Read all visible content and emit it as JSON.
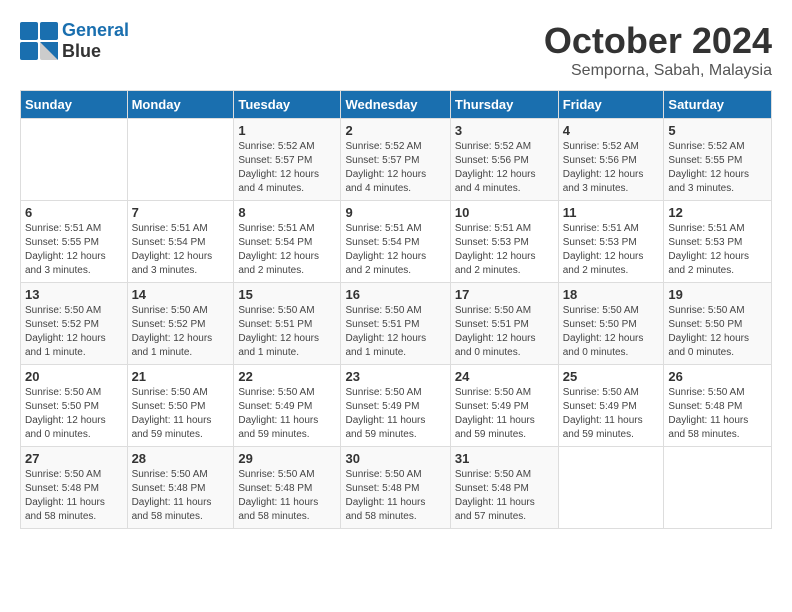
{
  "logo": {
    "line1": "General",
    "line2": "Blue"
  },
  "title": "October 2024",
  "location": "Semporna, Sabah, Malaysia",
  "weekdays": [
    "Sunday",
    "Monday",
    "Tuesday",
    "Wednesday",
    "Thursday",
    "Friday",
    "Saturday"
  ],
  "weeks": [
    [
      {
        "day": "",
        "content": ""
      },
      {
        "day": "",
        "content": ""
      },
      {
        "day": "1",
        "content": "Sunrise: 5:52 AM\nSunset: 5:57 PM\nDaylight: 12 hours\nand 4 minutes."
      },
      {
        "day": "2",
        "content": "Sunrise: 5:52 AM\nSunset: 5:57 PM\nDaylight: 12 hours\nand 4 minutes."
      },
      {
        "day": "3",
        "content": "Sunrise: 5:52 AM\nSunset: 5:56 PM\nDaylight: 12 hours\nand 4 minutes."
      },
      {
        "day": "4",
        "content": "Sunrise: 5:52 AM\nSunset: 5:56 PM\nDaylight: 12 hours\nand 3 minutes."
      },
      {
        "day": "5",
        "content": "Sunrise: 5:52 AM\nSunset: 5:55 PM\nDaylight: 12 hours\nand 3 minutes."
      }
    ],
    [
      {
        "day": "6",
        "content": "Sunrise: 5:51 AM\nSunset: 5:55 PM\nDaylight: 12 hours\nand 3 minutes."
      },
      {
        "day": "7",
        "content": "Sunrise: 5:51 AM\nSunset: 5:54 PM\nDaylight: 12 hours\nand 3 minutes."
      },
      {
        "day": "8",
        "content": "Sunrise: 5:51 AM\nSunset: 5:54 PM\nDaylight: 12 hours\nand 2 minutes."
      },
      {
        "day": "9",
        "content": "Sunrise: 5:51 AM\nSunset: 5:54 PM\nDaylight: 12 hours\nand 2 minutes."
      },
      {
        "day": "10",
        "content": "Sunrise: 5:51 AM\nSunset: 5:53 PM\nDaylight: 12 hours\nand 2 minutes."
      },
      {
        "day": "11",
        "content": "Sunrise: 5:51 AM\nSunset: 5:53 PM\nDaylight: 12 hours\nand 2 minutes."
      },
      {
        "day": "12",
        "content": "Sunrise: 5:51 AM\nSunset: 5:53 PM\nDaylight: 12 hours\nand 2 minutes."
      }
    ],
    [
      {
        "day": "13",
        "content": "Sunrise: 5:50 AM\nSunset: 5:52 PM\nDaylight: 12 hours\nand 1 minute."
      },
      {
        "day": "14",
        "content": "Sunrise: 5:50 AM\nSunset: 5:52 PM\nDaylight: 12 hours\nand 1 minute."
      },
      {
        "day": "15",
        "content": "Sunrise: 5:50 AM\nSunset: 5:51 PM\nDaylight: 12 hours\nand 1 minute."
      },
      {
        "day": "16",
        "content": "Sunrise: 5:50 AM\nSunset: 5:51 PM\nDaylight: 12 hours\nand 1 minute."
      },
      {
        "day": "17",
        "content": "Sunrise: 5:50 AM\nSunset: 5:51 PM\nDaylight: 12 hours\nand 0 minutes."
      },
      {
        "day": "18",
        "content": "Sunrise: 5:50 AM\nSunset: 5:50 PM\nDaylight: 12 hours\nand 0 minutes."
      },
      {
        "day": "19",
        "content": "Sunrise: 5:50 AM\nSunset: 5:50 PM\nDaylight: 12 hours\nand 0 minutes."
      }
    ],
    [
      {
        "day": "20",
        "content": "Sunrise: 5:50 AM\nSunset: 5:50 PM\nDaylight: 12 hours\nand 0 minutes."
      },
      {
        "day": "21",
        "content": "Sunrise: 5:50 AM\nSunset: 5:50 PM\nDaylight: 11 hours\nand 59 minutes."
      },
      {
        "day": "22",
        "content": "Sunrise: 5:50 AM\nSunset: 5:49 PM\nDaylight: 11 hours\nand 59 minutes."
      },
      {
        "day": "23",
        "content": "Sunrise: 5:50 AM\nSunset: 5:49 PM\nDaylight: 11 hours\nand 59 minutes."
      },
      {
        "day": "24",
        "content": "Sunrise: 5:50 AM\nSunset: 5:49 PM\nDaylight: 11 hours\nand 59 minutes."
      },
      {
        "day": "25",
        "content": "Sunrise: 5:50 AM\nSunset: 5:49 PM\nDaylight: 11 hours\nand 59 minutes."
      },
      {
        "day": "26",
        "content": "Sunrise: 5:50 AM\nSunset: 5:48 PM\nDaylight: 11 hours\nand 58 minutes."
      }
    ],
    [
      {
        "day": "27",
        "content": "Sunrise: 5:50 AM\nSunset: 5:48 PM\nDaylight: 11 hours\nand 58 minutes."
      },
      {
        "day": "28",
        "content": "Sunrise: 5:50 AM\nSunset: 5:48 PM\nDaylight: 11 hours\nand 58 minutes."
      },
      {
        "day": "29",
        "content": "Sunrise: 5:50 AM\nSunset: 5:48 PM\nDaylight: 11 hours\nand 58 minutes."
      },
      {
        "day": "30",
        "content": "Sunrise: 5:50 AM\nSunset: 5:48 PM\nDaylight: 11 hours\nand 58 minutes."
      },
      {
        "day": "31",
        "content": "Sunrise: 5:50 AM\nSunset: 5:48 PM\nDaylight: 11 hours\nand 57 minutes."
      },
      {
        "day": "",
        "content": ""
      },
      {
        "day": "",
        "content": ""
      }
    ]
  ]
}
